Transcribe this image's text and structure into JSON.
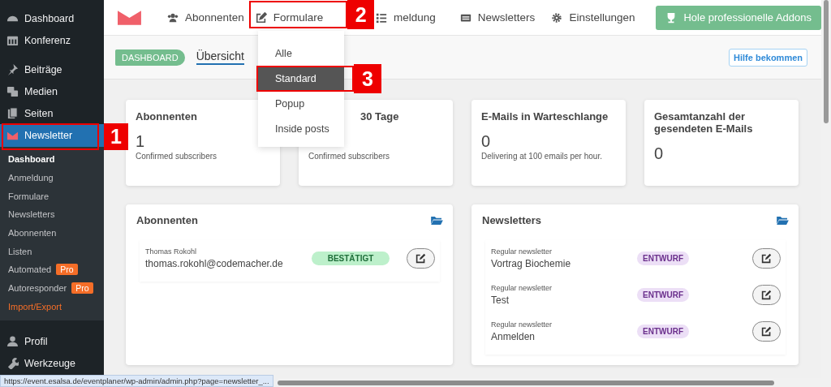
{
  "sidebar": {
    "items": [
      {
        "label": "Dashboard",
        "selected": false
      },
      {
        "label": "Konferenz",
        "selected": false
      },
      {
        "label": "Beiträge",
        "selected": false
      },
      {
        "label": "Medien",
        "selected": false
      },
      {
        "label": "Seiten",
        "selected": false
      },
      {
        "label": "Newsletter",
        "selected": true,
        "children": [
          {
            "label": "Dashboard",
            "selected": true,
            "hovered": false
          },
          {
            "label": "Anmeldung",
            "selected": false,
            "hovered": false
          },
          {
            "label": "Formulare",
            "selected": false,
            "hovered": false
          },
          {
            "label": "Newsletters",
            "selected": false,
            "hovered": false
          },
          {
            "label": "Abonnenten",
            "selected": false,
            "hovered": false
          },
          {
            "label": "Listen",
            "selected": false,
            "hovered": false
          },
          {
            "label": "Automated",
            "badge": "Pro",
            "selected": false,
            "hovered": false
          },
          {
            "label": "Autoresponder",
            "badge": "Pro",
            "selected": false,
            "hovered": false
          },
          {
            "label": "Import/Export",
            "selected": false,
            "hovered": true
          }
        ]
      },
      {
        "label": "Profil",
        "selected": false
      },
      {
        "label": "Werkzeuge",
        "selected": false
      }
    ]
  },
  "nav": {
    "items": [
      {
        "label": "Abonnenten"
      },
      {
        "label": "Formulare"
      },
      {
        "label": "meldung"
      },
      {
        "label": "Newsletters"
      },
      {
        "label": "Einstellungen"
      }
    ],
    "addons_button": "Hole professionelle Addons"
  },
  "dropdown": {
    "items": [
      {
        "label": "Alle",
        "selected": false
      },
      {
        "label": "Standard",
        "selected": true
      },
      {
        "label": "Popup",
        "selected": false
      },
      {
        "label": "Inside posts",
        "selected": false
      }
    ]
  },
  "subbar": {
    "badge": "DASHBOARD",
    "tabs": [
      {
        "label": "Übersicht",
        "selected": true
      }
    ],
    "help_button": "Hilfe bekommen"
  },
  "stats": [
    {
      "title": "Abonnenten",
      "value": "1",
      "note": "Confirmed subscribers"
    },
    {
      "title": "30 Tage",
      "note": "Confirmed subscribers"
    },
    {
      "title": "E-Mails in Warteschlange",
      "value": "0",
      "note": "Delivering at 100 emails per hour."
    },
    {
      "title": "Gesamtanzahl der gesendeten E-Mails",
      "value": "0"
    }
  ],
  "subscribers": {
    "title": "Abonnenten",
    "rows": [
      {
        "name": "Thomas Rokohl",
        "email": "thomas.rokohl@codemacher.de",
        "status": "BESTÄTIGT",
        "kind": "confirmed"
      }
    ]
  },
  "newsletters": {
    "title": "Newsletters",
    "rows": [
      {
        "type": "Regular newsletter",
        "subject": "Vortrag Biochemie",
        "status": "ENTWURF",
        "kind": "draft"
      },
      {
        "type": "Regular newsletter",
        "subject": "Test",
        "status": "ENTWURF",
        "kind": "draft"
      },
      {
        "type": "Regular newsletter",
        "subject": "Anmelden",
        "status": "ENTWURF",
        "kind": "draft"
      }
    ]
  },
  "callouts": [
    {
      "number": "1"
    },
    {
      "number": "2"
    },
    {
      "number": "3"
    }
  ],
  "status_url": "https://event.esalsa.de/eventplaner/wp-admin/admin.php?page=newsletter_..."
}
